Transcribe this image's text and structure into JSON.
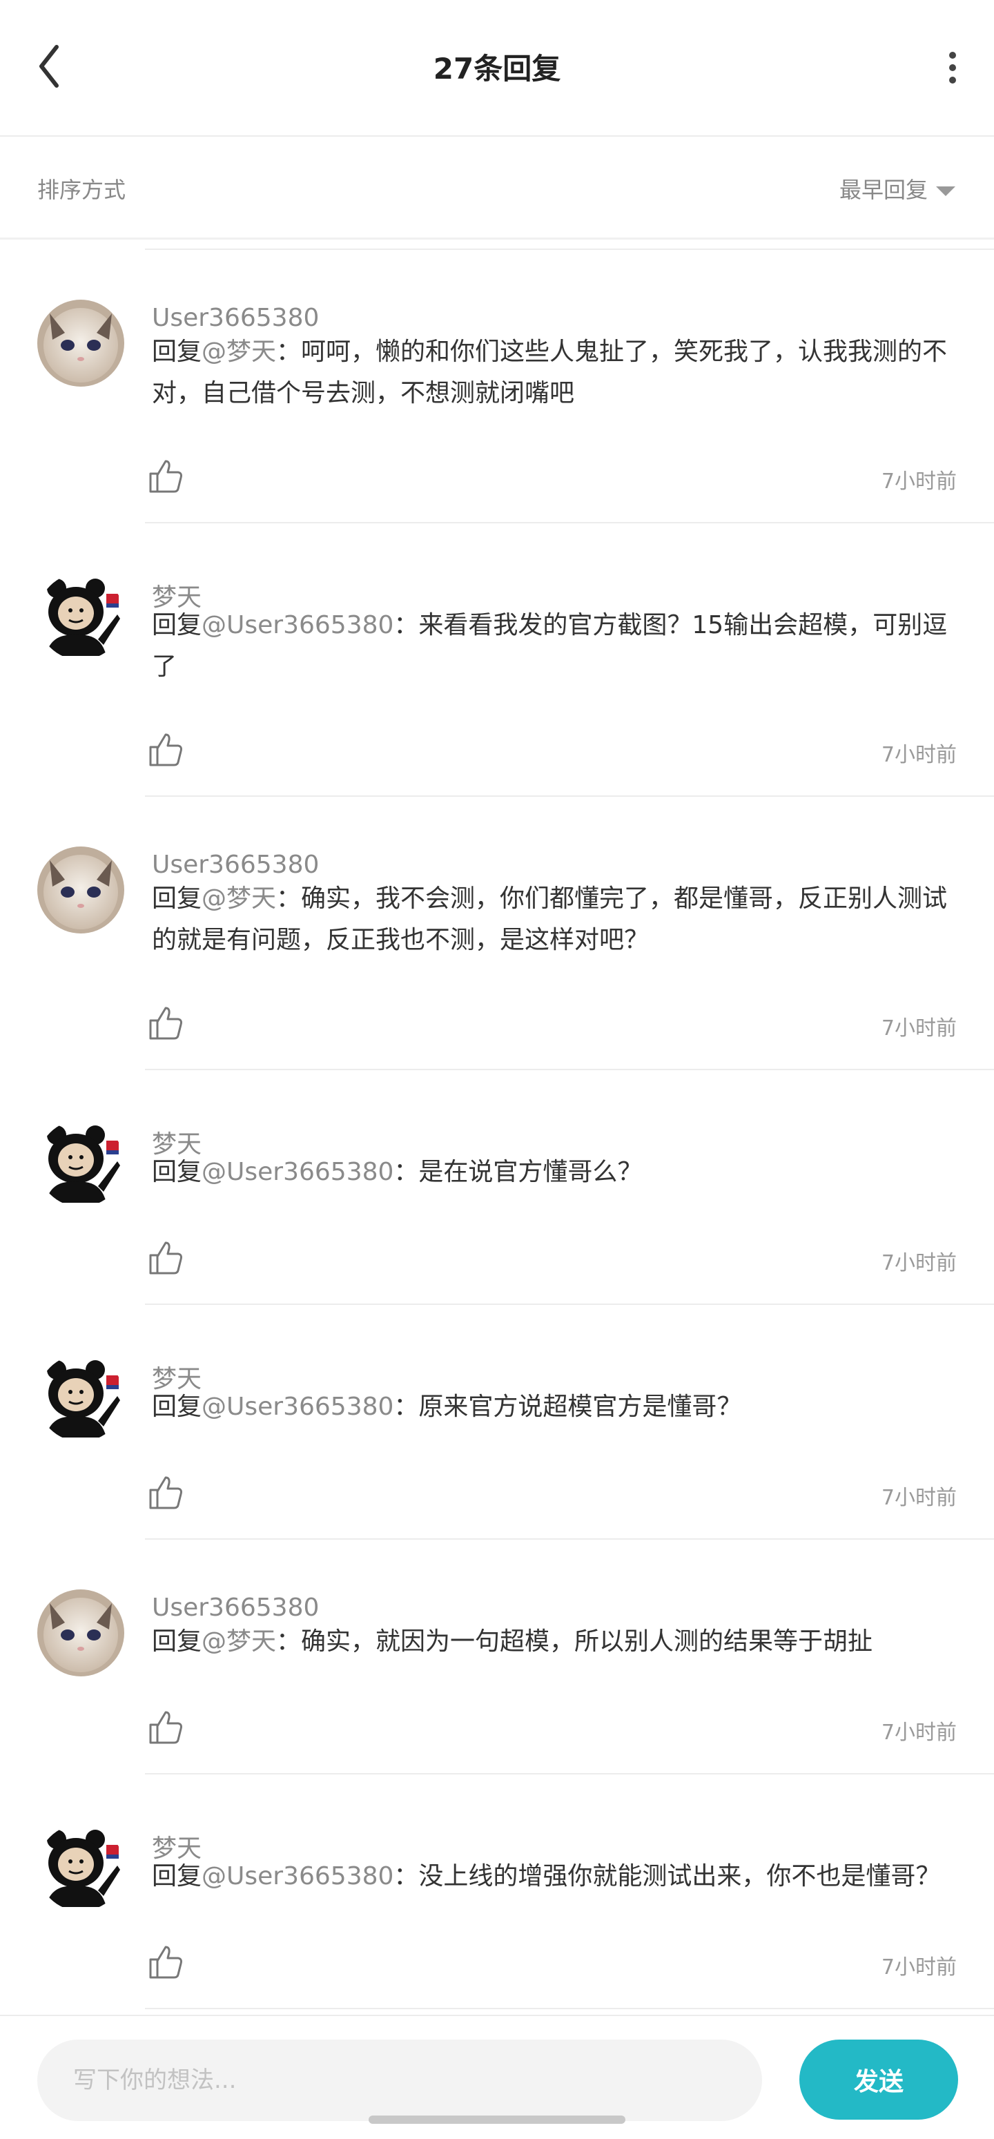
{
  "header": {
    "title": "27条回复",
    "back_icon": "chevron-left-icon",
    "more_icon": "vertical-dots-icon"
  },
  "sort": {
    "label": "排序方式",
    "selected": "最早回复"
  },
  "replies": [
    {
      "user": "User3665380",
      "avatar": "cat-avatar",
      "prefix": "回复",
      "mention": "@梦天",
      "body": "：呵呵，懒的和你们这些人鬼扯了，笑死我了，认我我测的不对，自己借个号去测，不想测就闭嘴吧",
      "time": "7小时前"
    },
    {
      "user": "梦天",
      "avatar": "panda-meme-avatar",
      "prefix": "回复",
      "mention": "@User3665380",
      "body": "：来看看我发的官方截图？15输出会超模，可别逗了",
      "time": "7小时前"
    },
    {
      "user": "User3665380",
      "avatar": "cat-avatar",
      "prefix": "回复",
      "mention": "@梦天",
      "body": "：确实，我不会测，你们都懂完了，都是懂哥，反正别人测试的就是有问题，反正我也不测，是这样对吧？",
      "time": "7小时前"
    },
    {
      "user": "梦天",
      "avatar": "panda-meme-avatar",
      "prefix": "回复",
      "mention": "@User3665380",
      "body": "：是在说官方懂哥么？",
      "time": "7小时前"
    },
    {
      "user": "梦天",
      "avatar": "panda-meme-avatar",
      "prefix": "回复",
      "mention": "@User3665380",
      "body": "：原来官方说超模官方是懂哥？",
      "time": "7小时前"
    },
    {
      "user": "User3665380",
      "avatar": "cat-avatar",
      "prefix": "回复",
      "mention": "@梦天",
      "body": "：确实，就因为一句超模，所以别人测的结果等于胡扯",
      "time": "7小时前"
    },
    {
      "user": "梦天",
      "avatar": "panda-meme-avatar",
      "prefix": "回复",
      "mention": "@User3665380",
      "body": "：没上线的增强你就能测试出来，你不也是懂哥？",
      "time": "7小时前"
    }
  ],
  "composer": {
    "placeholder": "写下你的想法...",
    "send_label": "发送"
  },
  "colors": {
    "accent": "#23b9c6"
  }
}
